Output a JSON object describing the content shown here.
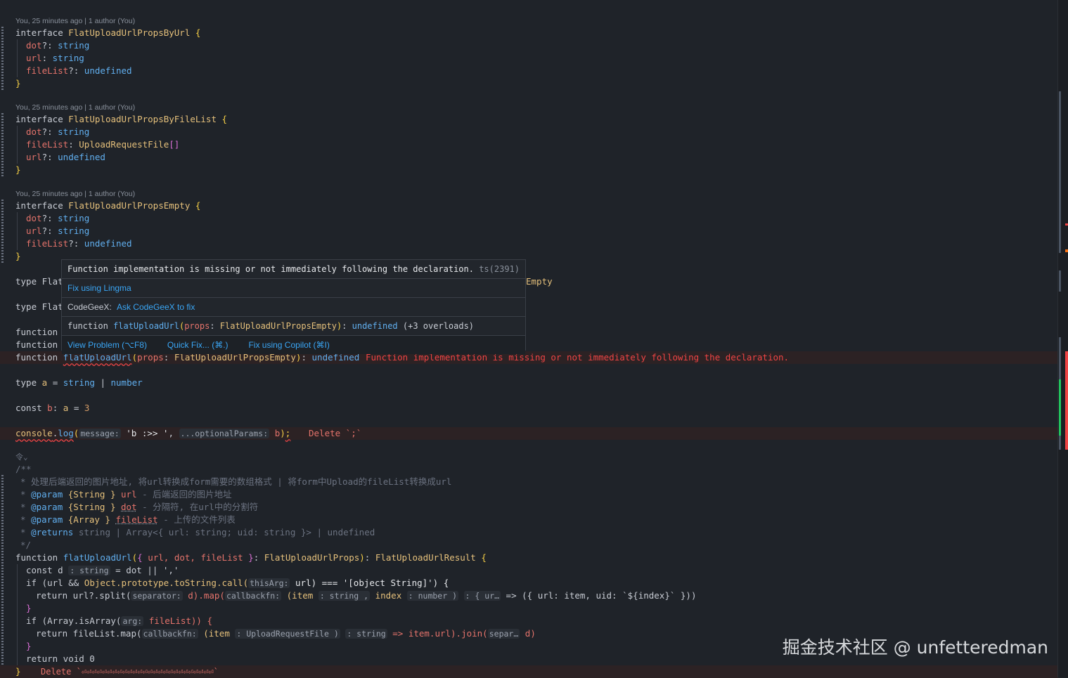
{
  "codelens": {
    "a": "You, 25 minutes ago | 1 author (You)",
    "b": "You, 25 minutes ago | 1 author (You)",
    "c": "You, 25 minutes ago | 1 author (You)"
  },
  "iface1": {
    "kw": "interface",
    "name": "FlatUploadUrlPropsByUrl",
    "p1": "dot",
    "p1t": "string",
    "p2": "url",
    "p2t": "string",
    "p3": "fileList",
    "p3t": "undefined"
  },
  "iface2": {
    "kw": "interface",
    "name": "FlatUploadUrlPropsByFileList",
    "p1": "dot",
    "p1t": "string",
    "p2": "fileList",
    "p2t": "UploadRequestFile",
    "p3": "url",
    "p3t": "undefined"
  },
  "iface3": {
    "kw": "interface",
    "name": "FlatUploadUrlPropsEmpty",
    "p1": "dot",
    "p1t": "string",
    "p2": "url",
    "p2t": "string",
    "p3": "fileList",
    "p3t": "undefined"
  },
  "partial": {
    "type1": "type Flat",
    "type1_tail": "Empty",
    "type2": "type Flat",
    "fn1": "function",
    "fn2": "function"
  },
  "popup": {
    "error_msg": "Function implementation is missing or not immediately following the declaration.",
    "error_code": "ts(2391)",
    "fix_lingma": "Fix using Lingma",
    "codegeex_prefix": "CodeGeeX:",
    "codegeex_link": "Ask CodeGeeX to fix",
    "signature_kw": "function",
    "signature_name": "flatUploadUrl",
    "signature_param": "props",
    "signature_type": "FlatUploadUrlPropsEmpty",
    "signature_ret": "undefined",
    "signature_overloads": "(+3 overloads)",
    "action_view": "View Problem (⌥F8)",
    "action_quickfix": "Quick Fix... (⌘.)",
    "action_copilot": "Fix using Copilot (⌘I)"
  },
  "errline1": {
    "kw": "function",
    "name": "flatUploadUrl",
    "param": "props",
    "type": "FlatUploadUrlPropsEmpty",
    "ret": "undefined",
    "inline_error": "Function implementation is missing or not immediately following the declaration."
  },
  "typea": {
    "kw": "type",
    "name": "a",
    "t1": "string",
    "t2": "number"
  },
  "constb": {
    "kw": "const",
    "name": "b",
    "type": "a",
    "val": "3"
  },
  "consolelog": {
    "obj": "console",
    "method": "log",
    "hint_msg": "message:",
    "arg1": "'b :>> '",
    "hint_opt": "...optionalParams:",
    "arg2": "b",
    "delete_hint": "Delete `;`"
  },
  "doc": {
    "marker": "令",
    "open": "/**",
    "desc": "* 处理后端返回的图片地址, 将url转换成form需要的数组格式 | 将form中Upload的fileList转换成url",
    "p1_tag": "@param",
    "p1_type": "{String }",
    "p1_name": "url",
    "p1_desc": "- 后端返回的图片地址",
    "p2_tag": "@param",
    "p2_type": "{String }",
    "p2_name": "dot",
    "p2_desc": "- 分隔符, 在url中的分割符",
    "p3_tag": "@param",
    "p3_type": "{Array }",
    "p3_name": "fileList",
    "p3_desc": "- 上传的文件列表",
    "ret_tag": "@returns",
    "ret_desc": "string | Array<{ url: string; uid: string }> | undefined",
    "close": "*/"
  },
  "impl": {
    "kw": "function",
    "name": "flatUploadUrl",
    "args": "url, dot, fileList",
    "ptype": "FlatUploadUrlProps",
    "rtype": "FlatUploadUrlResult",
    "l1": "const d",
    "l1_hint": ": string",
    "l1_rest": "= dot || ','",
    "l2_if": "if (url &&",
    "l2_obj": "Object.prototype.toString.call(",
    "l2_hint": "thisArg:",
    "l2_rest": "url) === '[object String]') {",
    "l3_ret": "return url?.split(",
    "l3_hint1": "separator:",
    "l3_mid": "d).map(",
    "l3_hint2": "callbackfn:",
    "l3_item": "(item",
    "l3_hint3": ": string ,",
    "l3_index": "index",
    "l3_hint4": ": number )",
    "l3_hint5": ": { ur…",
    "l3_tail": "=> ({ url: item, uid: `${index}` }))",
    "l4": "}",
    "l5_if": "if (Array.isArray(",
    "l5_hint": "arg:",
    "l5_rest": "fileList)) {",
    "l6_ret": "return fileList.map(",
    "l6_hint1": "callbackfn:",
    "l6_item": "(item",
    "l6_hint2": ": UploadRequestFile )",
    "l6_hint3": ": string",
    "l6_tail": "=> item.url).join(",
    "l6_hint4": "separ…",
    "l6_end": "d)",
    "l7": "}",
    "l8": "return void 0",
    "l9": "}",
    "delete_hint": "Delete `⏎⏎⏎⏎⏎⏎⏎⏎⏎⏎⏎⏎⏎⏎⏎⏎⏎⏎⏎⏎⏎⏎⏎⏎⏎⏎`"
  },
  "watermark": "掘金技术社区 @ unfetteredman",
  "colors": {
    "error": "#ef4444",
    "link": "#3aa6f5",
    "keyword": "#c8ccd4"
  }
}
